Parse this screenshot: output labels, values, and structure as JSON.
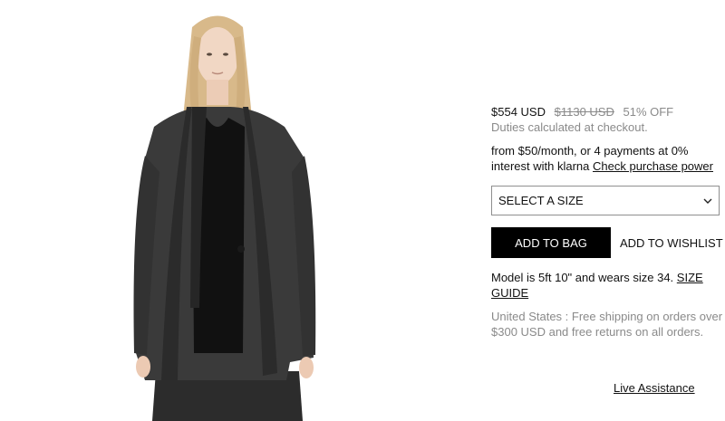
{
  "product": {
    "price_current": "$554 USD",
    "price_original": "$1130 USD",
    "discount": "51% OFF",
    "duties_note": "Duties calculated at checkout.",
    "klarna_text": "from $50/month, or 4 payments at 0% interest with klarna",
    "klarna_link": "Check purchase power",
    "size_select": {
      "selected": "SELECT A SIZE"
    },
    "add_to_bag_label": "ADD TO BAG",
    "add_to_wishlist_label": "ADD TO WISHLIST",
    "model_info_text": "Model is 5ft 10\" and wears size 34.",
    "size_guide_link": "SIZE GUIDE",
    "shipping_note": "United States : Free shipping on orders over $300 USD and free returns on all orders.",
    "live_assistance_link": "Live Assistance"
  },
  "icons": {
    "size_chevron": "chevron-down-icon"
  }
}
